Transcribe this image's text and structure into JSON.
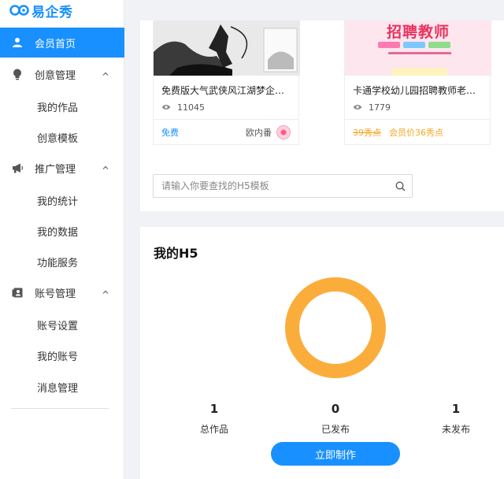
{
  "brand": {
    "name": "易企秀",
    "color": "#1890ff"
  },
  "sidebar": {
    "items": [
      {
        "label": "会员首页",
        "icon": "user-icon",
        "active": true
      },
      {
        "label": "创意管理",
        "icon": "lightbulb-icon",
        "expanded": true,
        "children": [
          {
            "label": "我的作品"
          },
          {
            "label": "创意模板"
          }
        ]
      },
      {
        "label": "推广管理",
        "icon": "megaphone-icon",
        "expanded": true,
        "children": [
          {
            "label": "我的统计"
          },
          {
            "label": "我的数据"
          },
          {
            "label": "功能服务"
          }
        ]
      },
      {
        "label": "账号管理",
        "icon": "id-card-icon",
        "expanded": true,
        "children": [
          {
            "label": "账号设置"
          },
          {
            "label": "我的账号"
          },
          {
            "label": "消息管理"
          }
        ]
      }
    ]
  },
  "templates": [
    {
      "title": "免费版大气武侠风江湖梦企业...",
      "views": "11045",
      "price_label": "免费",
      "author": "欧内番"
    },
    {
      "title": "卡通学校幼儿园招聘教师老师...",
      "views": "1779",
      "banner_text": "招聘教师",
      "old_price": "39秀点",
      "vip_price": "会员价36秀点"
    }
  ],
  "search": {
    "placeholder": "请输入你要查找的H5模板",
    "value": ""
  },
  "my_h5": {
    "title": "我的H5",
    "ring_color": "#fbad3c",
    "stats": [
      {
        "value": "1",
        "label": "总作品"
      },
      {
        "value": "0",
        "label": "已发布"
      },
      {
        "value": "1",
        "label": "未发布"
      }
    ],
    "create_button": "立即制作"
  }
}
